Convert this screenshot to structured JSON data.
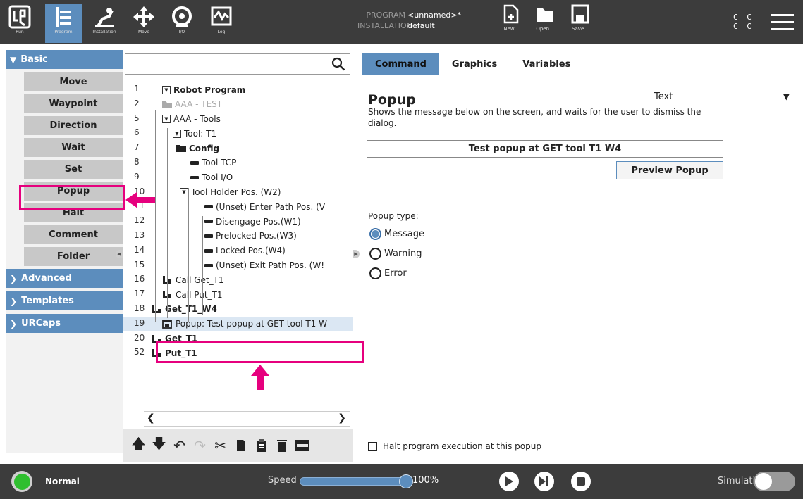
{
  "topbar": {
    "nav": [
      {
        "label": "Run",
        "icon": "ur-logo-icon"
      },
      {
        "label": "Program",
        "icon": "program-icon"
      },
      {
        "label": "Installation",
        "icon": "installation-icon"
      },
      {
        "label": "Move",
        "icon": "move-icon"
      },
      {
        "label": "I/O",
        "icon": "io-icon"
      },
      {
        "label": "Log",
        "icon": "log-icon"
      }
    ],
    "program_key": "PROGRAM",
    "program_value": "<unnamed>*",
    "installation_key": "INSTALLATION",
    "installation_value": "default",
    "file_buttons": [
      {
        "label": "New...",
        "icon": "new-file-icon"
      },
      {
        "label": "Open...",
        "icon": "open-folder-icon"
      },
      {
        "label": "Save...",
        "icon": "save-icon"
      }
    ],
    "cc_line1": "C C",
    "cc_line2": "C C"
  },
  "left": {
    "basic_label": "Basic",
    "basic_items": [
      "Move",
      "Waypoint",
      "Direction",
      "Wait",
      "Set",
      "Popup",
      "Halt",
      "Comment",
      "Folder"
    ],
    "other_categories": [
      "Advanced",
      "Templates",
      "URCaps"
    ]
  },
  "tree": {
    "rows": [
      {
        "num": "1",
        "text": "Robot Program",
        "bold": true,
        "kind": "tri"
      },
      {
        "num": "2",
        "text": "AAA - TEST",
        "gray": true,
        "kind": "folder"
      },
      {
        "num": "5",
        "text": "AAA - Tools",
        "kind": "tri"
      },
      {
        "num": "6",
        "text": "Tool: T1",
        "kind": "tri"
      },
      {
        "num": "7",
        "text": "Config",
        "bold": true,
        "kind": "folder"
      },
      {
        "num": "8",
        "text": "Tool TCP",
        "kind": "dash"
      },
      {
        "num": "9",
        "text": "Tool I/O",
        "kind": "dash"
      },
      {
        "num": "10",
        "text": "Tool Holder Pos. (W2)",
        "kind": "tri"
      },
      {
        "num": "11",
        "text": "(Unset) Enter Path Pos. (V",
        "kind": "dash"
      },
      {
        "num": "12",
        "text": "Disengage Pos.(W1)",
        "kind": "dash"
      },
      {
        "num": "13",
        "text": "Prelocked Pos.(W3)",
        "kind": "dash"
      },
      {
        "num": "14",
        "text": "Locked Pos.(W4)",
        "kind": "dash"
      },
      {
        "num": "15",
        "text": "(Unset) Exit Path Pos. (W!",
        "kind": "dash"
      },
      {
        "num": "16",
        "text": "Call Get_T1",
        "kind": "call"
      },
      {
        "num": "17",
        "text": "Call Put_T1",
        "kind": "call"
      },
      {
        "num": "18",
        "text": "Get_T1_W4",
        "bold": true,
        "kind": "call"
      },
      {
        "num": "19",
        "text": "Popup: Test popup at GET tool T1 W",
        "kind": "popup"
      },
      {
        "num": "20",
        "text": "Get_T1",
        "bold": true,
        "kind": "call"
      },
      {
        "num": "52",
        "text": "Put_T1",
        "bold": true,
        "kind": "call"
      }
    ]
  },
  "right": {
    "tabs": [
      "Command",
      "Graphics",
      "Variables"
    ],
    "title": "Popup",
    "description": "Shows the message below on the screen, and waits for the user to dismiss the dialog.",
    "type_select_value": "Text",
    "message": "Test popup at GET tool T1 W4",
    "preview_button": "Preview Popup",
    "popup_type_label": "Popup type:",
    "popup_types": [
      "Message",
      "Warning",
      "Error"
    ],
    "selected_type": "Message",
    "halt_label": "Halt program execution at this popup"
  },
  "bottom": {
    "status": "Normal",
    "speed_label": "Speed",
    "speed_value": "100%",
    "speed_fraction": 1.0,
    "simulation_label": "Simulation"
  },
  "colors": {
    "accent": "#5c8dbd",
    "topbar": "#3c3c3c",
    "annotation": "#e6007e",
    "status_ok": "#2fbf2f"
  }
}
